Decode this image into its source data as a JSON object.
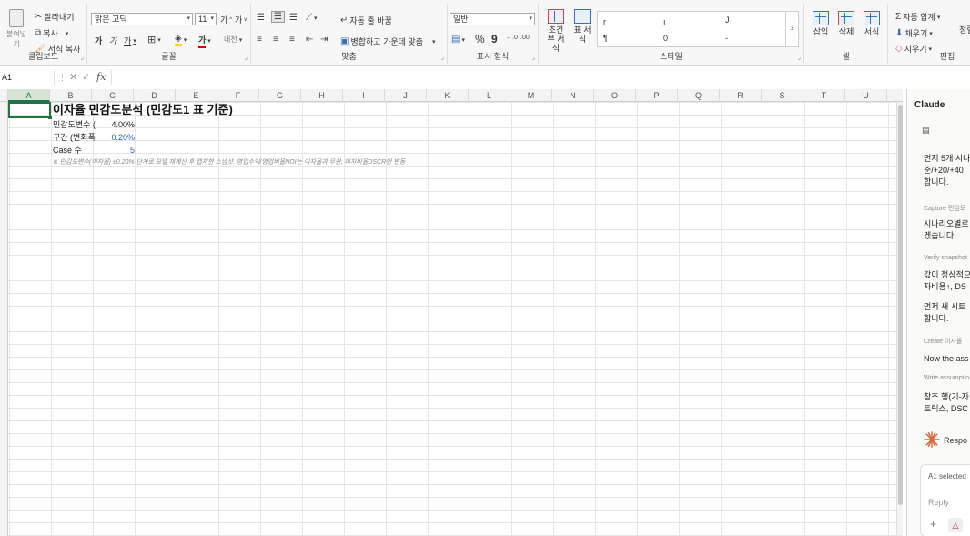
{
  "ribbon": {
    "clipboard": {
      "paste": "붙여넣기",
      "cut": "잘라내기",
      "copy": "복사",
      "format_painter": "서식 복사",
      "label": "클립보드"
    },
    "font": {
      "font_name": "맑은 고딕",
      "font_size": "11",
      "grow": "가",
      "shrink": "가",
      "bold": "가",
      "italic": "가",
      "underline": "가",
      "strike": "가",
      "phonetic": "내천",
      "label": "글꼴"
    },
    "alignment": {
      "wrap": "자동 줄 바꿈",
      "merge": "병합하고 가운데 맞춤",
      "label": "맞춤"
    },
    "number": {
      "format": "일반",
      "percent": "%",
      "comma": "9",
      "label": "표시 형식"
    },
    "styles": {
      "conditional": "조건부 서식",
      "table": "표 서식",
      "label": "스타일",
      "gallery": [
        "r",
        "ı",
        "J",
        "¶",
        "0",
        "-"
      ]
    },
    "cells": {
      "insert": "삽입",
      "delete": "삭제",
      "format": "서식",
      "label": "셀"
    },
    "editing": {
      "autosum": "자동 합계",
      "fill": "채우기",
      "clear": "지우기",
      "label": "편집",
      "sort": "정렬"
    }
  },
  "formula_bar": {
    "name_box": "A1",
    "fx": "fx",
    "content": ""
  },
  "columns": [
    "A",
    "B",
    "C",
    "D",
    "E",
    "F",
    "G",
    "H",
    "I",
    "J",
    "K",
    "L",
    "M",
    "N",
    "O",
    "P",
    "Q",
    "R",
    "S",
    "T",
    "U"
  ],
  "sheet": {
    "title": "이자율 민감도분석 (민감도1 표 기준)",
    "rows": [
      {
        "label": "민감도변수 (",
        "value": "4.00%"
      },
      {
        "label": "구간 (변화폭",
        "value": "0.20%"
      },
      {
        "label": "Case 수",
        "value": "5"
      }
    ],
    "note": "※ 민감도변수(이자율) ±0.20% 단계로 모델 재계산 후 캡처한 스냅샷. 영업수익/영업비율NOI는 이자율과 무관, 미자비율DSCR만 변동"
  },
  "panel": {
    "title": "Claude",
    "messages": [
      {
        "text": [
          "먼저 5개 시나",
          "준/+20/+40",
          "합니다."
        ]
      },
      {
        "step": "Capture 민감도"
      },
      {
        "text": [
          "시나리오별로",
          "겠습니다."
        ]
      },
      {
        "step": "Verify snapshot"
      },
      {
        "text": [
          "값이 정상적으",
          "자비용↑, DS"
        ]
      },
      {
        "text": [
          "먼저 새 시트",
          "합니다."
        ]
      },
      {
        "step": "Create 이자율"
      },
      {
        "text": [
          "Now the ass"
        ]
      },
      {
        "step": "Write assumptio"
      },
      {
        "text": [
          "참조 행(기-자",
          "트릭스, DSC"
        ]
      }
    ],
    "responding": "Respo",
    "selection_chip": "A1 selected",
    "reply_placeholder": "Reply"
  }
}
